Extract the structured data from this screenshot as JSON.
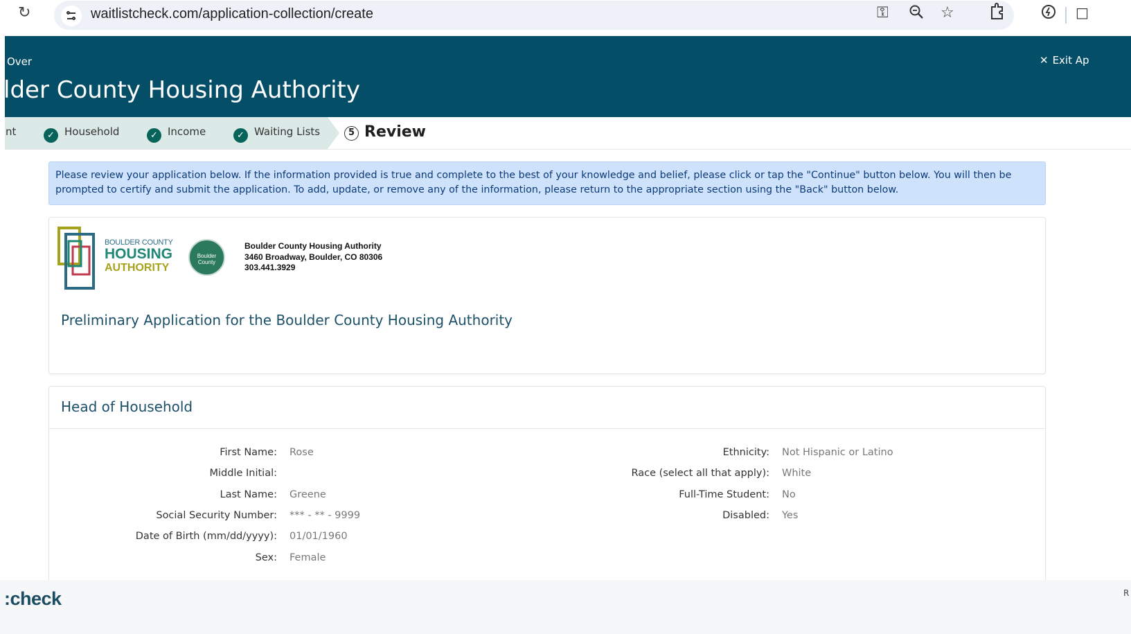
{
  "browser": {
    "url": "waitlistcheck.com/application-collection/create",
    "icons": [
      "reload-icon",
      "site-settings-icon",
      "key-icon",
      "zoom-icon",
      "star-icon",
      "extensions-icon",
      "tab-search-icon"
    ]
  },
  "header": {
    "start_over_label": "Over",
    "exit_label": "Exit Ap",
    "title": "lder County Housing Authority",
    "bg_color": "#054e67"
  },
  "stepper": {
    "steps": [
      {
        "label": "nt",
        "status": "complete"
      },
      {
        "label": "Household",
        "status": "complete"
      },
      {
        "label": "Income",
        "status": "complete"
      },
      {
        "label": "Waiting Lists",
        "status": "complete"
      }
    ],
    "current": {
      "number": "5",
      "label": "Review"
    },
    "complete_color": "#08645a"
  },
  "alert": {
    "text": "Please review your application below. If the information provided is true and complete to the best of your knowledge and belief, please click or tap the \"Continue\" button below. You will then be prompted to certify and submit the application. To add, update, or remove any of the information, please return to the appropriate section using the \"Back\" button below."
  },
  "intro_card": {
    "logo": {
      "small_text": "BOULDER COUNTY",
      "housing_text": "HOUSING",
      "authority_text": "AUTHORITY",
      "seal_text": "Boulder County"
    },
    "agency": {
      "name": "Boulder County Housing Authority",
      "address": "3460 Broadway, Boulder, CO 80306",
      "phone": "303.441.3929"
    },
    "title": "Preliminary Application for the Boulder County Housing Authority"
  },
  "head_of_household": {
    "title": "Head of Household",
    "left_fields": [
      {
        "label": "First Name:",
        "value": "Rose"
      },
      {
        "label": "Middle Initial:",
        "value": ""
      },
      {
        "label": "Last Name:",
        "value": "Greene"
      },
      {
        "label": "Social Security Number:",
        "value": "*** - ** - 9999"
      },
      {
        "label": "Date of Birth (mm/dd/yyyy):",
        "value": "01/01/1960"
      },
      {
        "label": "Sex:",
        "value": "Female"
      }
    ],
    "right_fields": [
      {
        "label": "Ethnicity:",
        "value": "Not Hispanic or Latino"
      },
      {
        "label": "Race (select all that apply):",
        "value": "White"
      },
      {
        "label": "Full-Time Student:",
        "value": "No"
      },
      {
        "label": "Disabled:",
        "value": "Yes"
      }
    ]
  },
  "footer": {
    "brand": ":check",
    "right_text": "R"
  }
}
